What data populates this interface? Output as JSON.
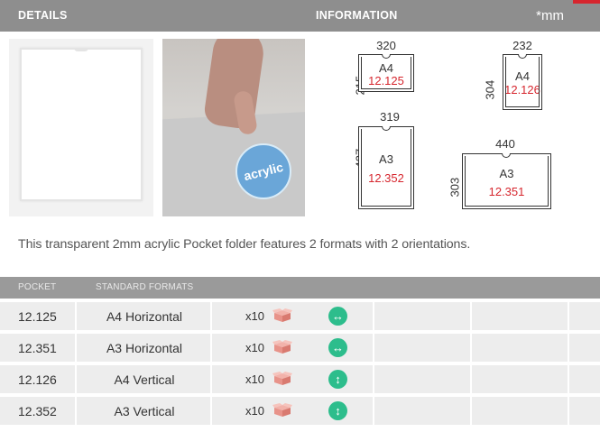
{
  "header": {
    "details_label": "DETAILS",
    "information_label": "INFORMATION",
    "unit_label": "*mm"
  },
  "images": {
    "badge_text": "acrylic"
  },
  "formats": [
    {
      "name": "A4",
      "code": "12.125",
      "width": "320",
      "height": "215"
    },
    {
      "name": "A4",
      "code": "12.126",
      "width": "232",
      "height": "304"
    },
    {
      "name": "A3",
      "code": "12.352",
      "width": "319",
      "height": "427"
    },
    {
      "name": "A3",
      "code": "12.351",
      "width": "440",
      "height": "303"
    }
  ],
  "description": "This transparent 2mm acrylic Pocket folder features 2 formats with 2 orientations.",
  "table": {
    "columns": [
      "POCKET",
      "STANDARD FORMATS"
    ],
    "rows": [
      {
        "code": "12.125",
        "format": "A4 Horizontal",
        "qty": "x10",
        "orientation": "horizontal",
        "orientation_glyph": "↔"
      },
      {
        "code": "12.351",
        "format": "A3 Horizontal",
        "qty": "x10",
        "orientation": "horizontal",
        "orientation_glyph": "↔"
      },
      {
        "code": "12.126",
        "format": "A4 Vertical",
        "qty": "x10",
        "orientation": "vertical",
        "orientation_glyph": "↕"
      },
      {
        "code": "12.352",
        "format": "A3 Vertical",
        "qty": "x10",
        "orientation": "vertical",
        "orientation_glyph": "↕"
      }
    ]
  },
  "colors": {
    "accent_red": "#d6262e",
    "orientation_green": "#2dbd8c",
    "header_grey": "#8e8e8e",
    "badge_blue": "#6aa6d8",
    "box_icon_pink": "#e8938a"
  }
}
